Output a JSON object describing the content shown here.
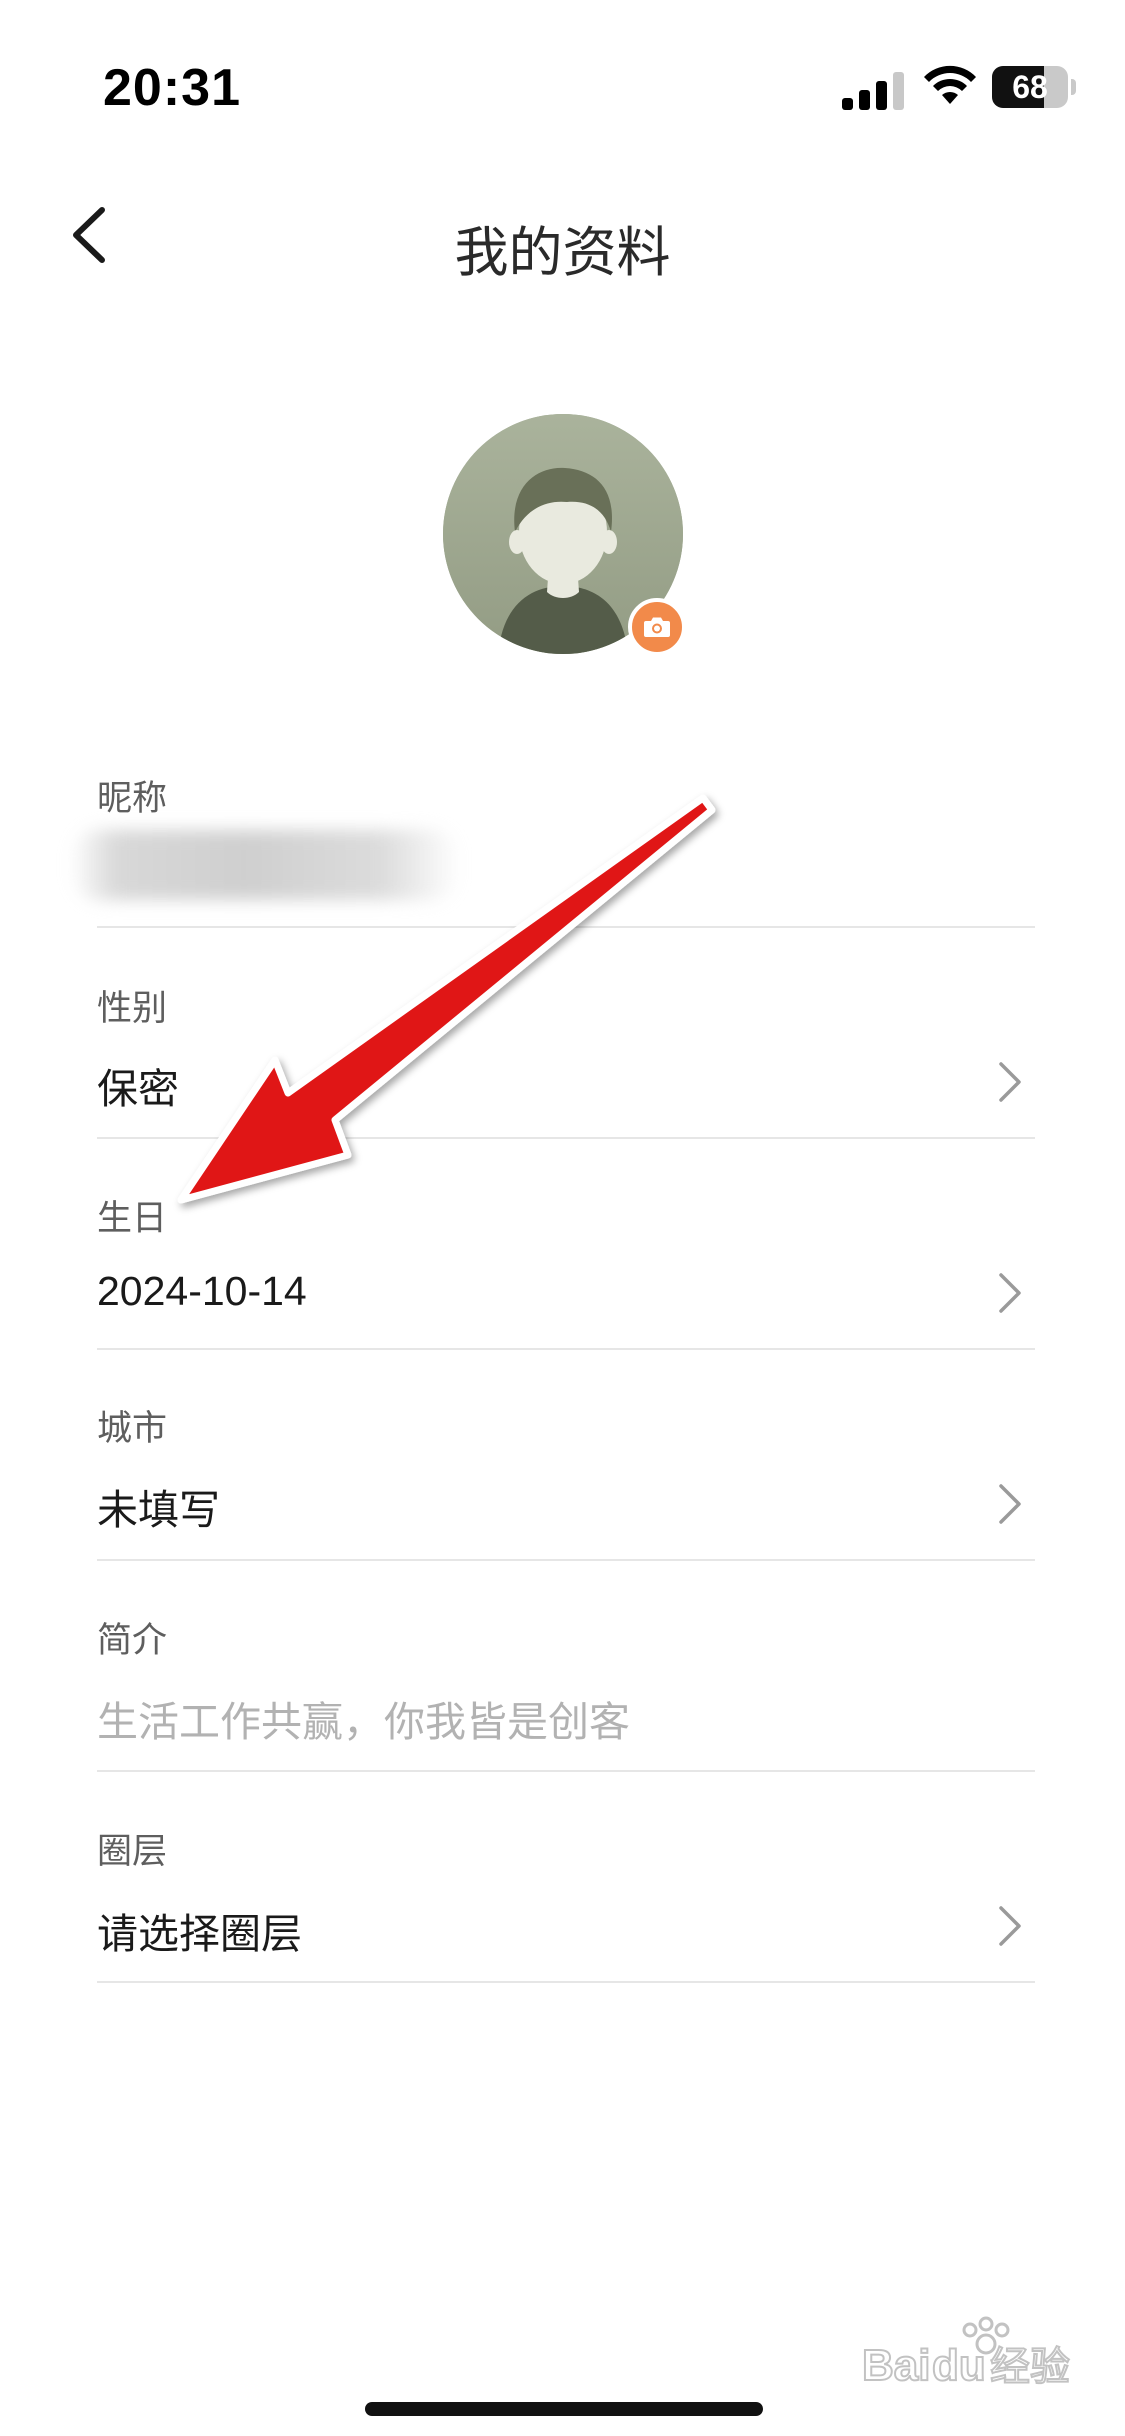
{
  "status_bar": {
    "time": "20:31",
    "battery_level": 68,
    "battery_text": "68"
  },
  "header": {
    "title": "我的资料"
  },
  "profile": {
    "fields": [
      {
        "label": "昵称",
        "value": ""
      },
      {
        "label": "性别",
        "value": "保密"
      },
      {
        "label": "生日",
        "value": "2024-10-14"
      },
      {
        "label": "城市",
        "value": "未填写"
      },
      {
        "label": "简介",
        "value": "生活工作共赢，你我皆是创客"
      },
      {
        "label": "圈层",
        "value": "请选择圈层"
      }
    ]
  },
  "colors": {
    "accent": "#f28a4a",
    "annotation_arrow": "#e01616",
    "avatar_bg": "#a4ad95"
  },
  "watermark": {
    "text": "Baidu经验"
  }
}
